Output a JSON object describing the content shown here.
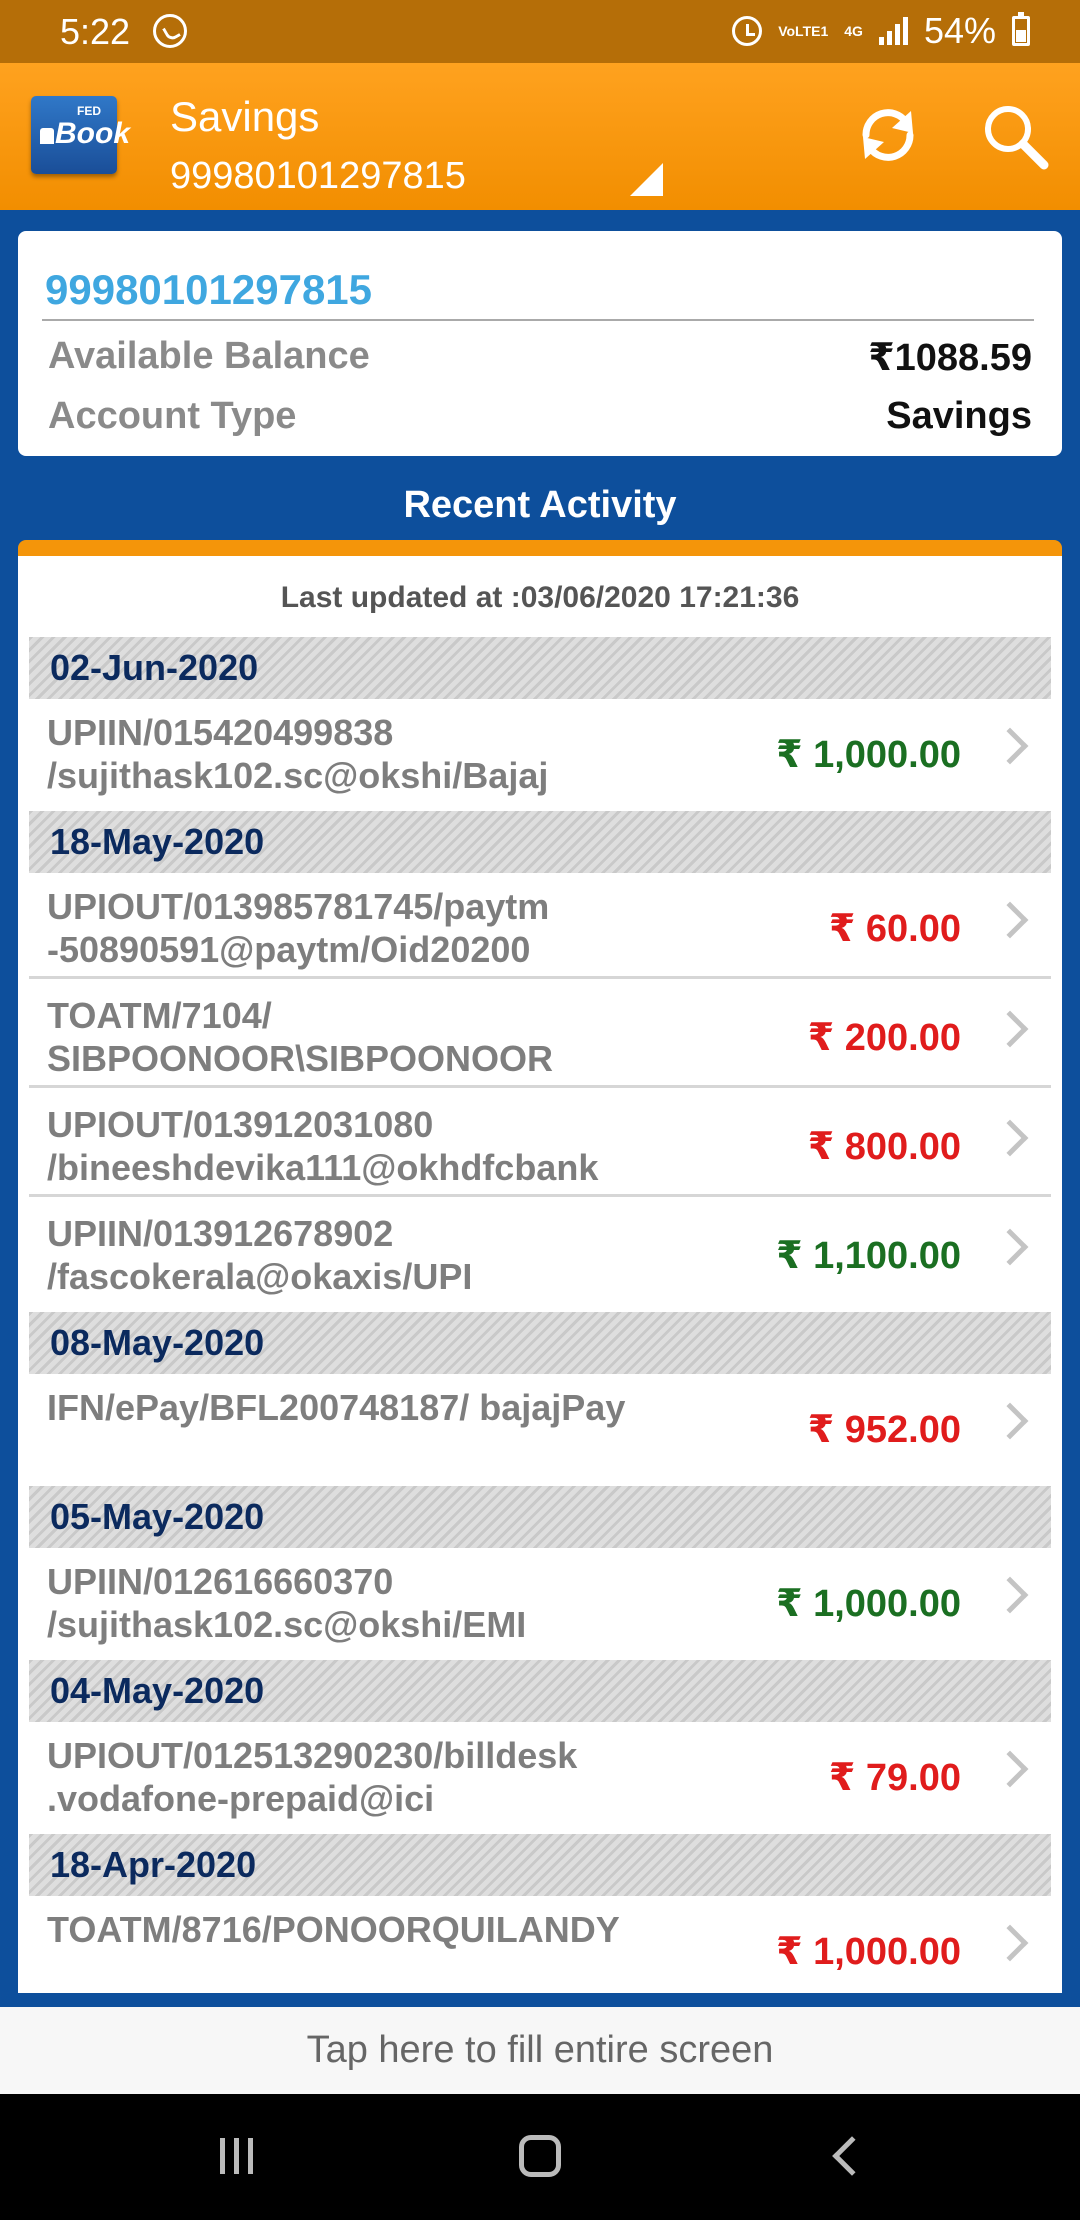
{
  "status_bar": {
    "time": "5:22",
    "battery": "54%",
    "volte": "VoLTE1",
    "network": "4G"
  },
  "header": {
    "title": "Savings",
    "account_number": "99980101297815",
    "logo_line1": "FED",
    "logo_line2": "Book"
  },
  "account": {
    "number": "99980101297815",
    "available_balance_label": "Available Balance",
    "available_balance_value": "₹1088.59",
    "account_type_label": "Account Type",
    "account_type_value": "Savings"
  },
  "recent_activity": {
    "title": "Recent Activity",
    "last_updated": "Last updated at :03/06/2020 17:21:36",
    "groups": [
      {
        "date": "02-Jun-2020",
        "transactions": [
          {
            "description": "UPIIN/015420499838 /sujithask102.sc@okshi/Bajaj",
            "amount": "₹ 1,000.00",
            "type": "credit"
          }
        ]
      },
      {
        "date": "18-May-2020",
        "transactions": [
          {
            "description": "UPIOUT/013985781745/paytm -50890591@paytm/Oid20200",
            "amount": "₹ 60.00",
            "type": "debit"
          },
          {
            "description": "TOATM/7104/ SIBPOONOOR\\SIBPOONOOR",
            "amount": "₹ 200.00",
            "type": "debit"
          },
          {
            "description": "UPIOUT/013912031080 /bineeshdevika111@okhdfcbank",
            "amount": "₹ 800.00",
            "type": "debit"
          },
          {
            "description": "UPIIN/013912678902 /fascokerala@okaxis/UPI",
            "amount": "₹ 1,100.00",
            "type": "credit"
          }
        ]
      },
      {
        "date": "08-May-2020",
        "transactions": [
          {
            "description": "IFN/ePay/BFL200748187/ bajajPay",
            "amount": "₹ 952.00",
            "type": "debit"
          }
        ]
      },
      {
        "date": "05-May-2020",
        "transactions": [
          {
            "description": "UPIIN/012616660370 /sujithask102.sc@okshi/EMI",
            "amount": "₹ 1,000.00",
            "type": "credit"
          }
        ]
      },
      {
        "date": "04-May-2020",
        "transactions": [
          {
            "description": "UPIOUT/012513290230/billdesk .vodafone-prepaid@ici",
            "amount": "₹ 79.00",
            "type": "debit"
          }
        ]
      },
      {
        "date": "18-Apr-2020",
        "transactions": [
          {
            "description": "TOATM/8716/PONOORQUILANDY",
            "amount": "₹ 1,000.00",
            "type": "debit"
          }
        ]
      }
    ]
  },
  "fill_banner": {
    "text": "Tap here to fill entire screen"
  },
  "colors": {
    "app_bar": "#f7970f",
    "status_bar": "#b56e08",
    "background": "#0d4f9c",
    "credit": "#1b6f22",
    "debit": "#e01c1c",
    "account_number": "#3fa7e0"
  },
  "icons": {
    "refresh": "refresh-icon",
    "search": "search-icon",
    "dropdown": "dropdown-triangle-icon",
    "chevron": "chevron-right-icon"
  }
}
